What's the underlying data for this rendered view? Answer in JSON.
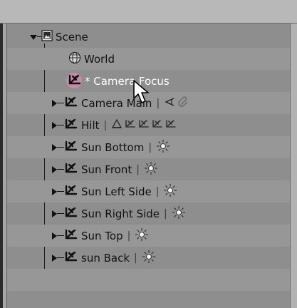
{
  "scene": {
    "label": "Scene",
    "expanded": true,
    "children": [
      {
        "label": "World",
        "type": "world"
      },
      {
        "label": "* Camera Focus",
        "type": "empty",
        "selected": true
      },
      {
        "label": "Camera Main",
        "type": "empty",
        "extra_icons": [
          "camera-icon",
          "constraint-icon"
        ]
      },
      {
        "label": "Hilt",
        "type": "empty",
        "extra_icons": [
          "mesh-icon",
          "empty-icon",
          "empty-icon",
          "empty-icon",
          "empty-icon"
        ]
      },
      {
        "label": "Sun Bottom",
        "type": "empty",
        "extra_icons": [
          "sun-icon"
        ]
      },
      {
        "label": "Sun Front",
        "type": "empty",
        "extra_icons": [
          "sun-icon"
        ]
      },
      {
        "label": "Sun Left Side",
        "type": "empty",
        "extra_icons": [
          "sun-icon"
        ]
      },
      {
        "label": "Sun Right Side",
        "type": "empty",
        "extra_icons": [
          "sun-icon"
        ]
      },
      {
        "label": "Sun Top",
        "type": "empty",
        "extra_icons": [
          "sun-icon"
        ]
      },
      {
        "label": "sun Back",
        "type": "empty",
        "extra_icons": [
          "sun-icon"
        ]
      }
    ]
  },
  "separator": "|",
  "colors": {
    "background": "#8e8e8e",
    "row_alt": "#979797",
    "selected_circle": "#c58aa8",
    "selected_text": "#ffffff"
  }
}
